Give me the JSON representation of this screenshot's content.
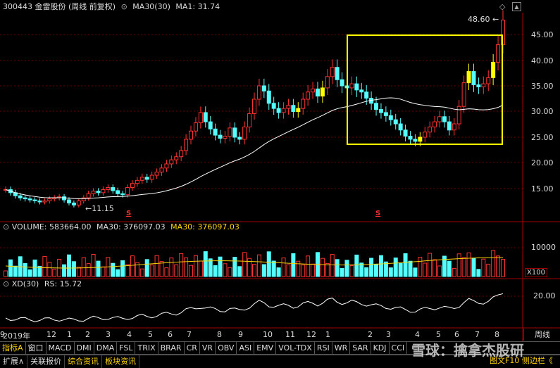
{
  "header": {
    "title": "300443 金雷股份 (周线 前复权)",
    "ma_label": "MA30(30)",
    "ma1_label": "MA1: 31.74"
  },
  "price_axis": [
    "45.00",
    "40.00",
    "35.00",
    "30.00",
    "25.00",
    "20.00",
    "15.00"
  ],
  "annotations": {
    "high": "48.60",
    "low": "11.15",
    "s_marker": "S"
  },
  "volume": {
    "label": "VOLUME: 583664.00",
    "ma30a": "MA30: 376097.03",
    "ma30b": "MA30: 376097.03",
    "axis_top": "10000",
    "unit": "X100"
  },
  "xd": {
    "label": "XD(30)",
    "rs": "RS: 15.72",
    "axis": "20.00"
  },
  "time_axis": [
    "2019年",
    "12",
    "1",
    "2",
    "3",
    "4",
    "5",
    "6",
    "7",
    "8",
    "9",
    "10",
    "11",
    "12",
    "1",
    "2",
    "3",
    "4",
    "5",
    "6",
    "7",
    "8",
    "9"
  ],
  "period_button": "周线",
  "indicator_tabs": [
    "指标A",
    "窗口",
    "MACD",
    "DMI",
    "DMA",
    "FSL",
    "TRIX",
    "BRAR",
    "CR",
    "VR",
    "OBV",
    "ASI",
    "EMV",
    "VOL-TDX",
    "RSI",
    "WR",
    "SAR",
    "KDJ",
    "CCI"
  ],
  "bottom_tabs": [
    "扩展∧",
    "关联报价",
    "综合资讯",
    "板块资讯"
  ],
  "watermark": "雪球：擒拿杰股研",
  "bottom_right": "图文F10  侧边栏《",
  "colors": {
    "up": "#ff3232",
    "down": "#54ffff",
    "ma": "#ffffff",
    "box": "#ffff00"
  }
}
